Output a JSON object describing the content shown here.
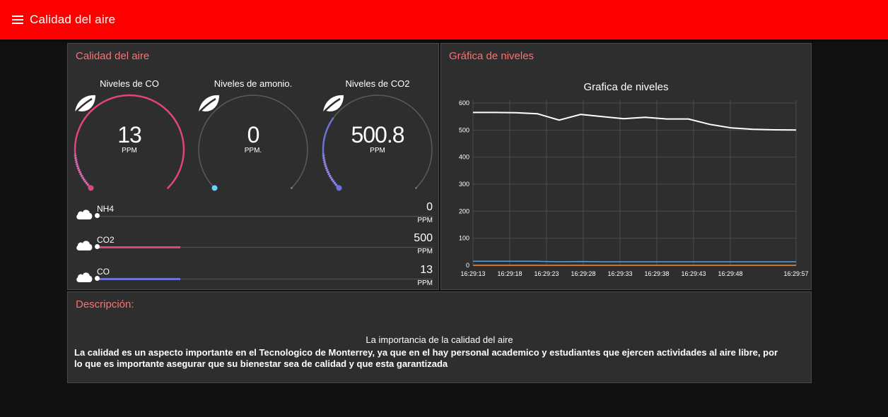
{
  "app": {
    "title": "Calidad del aire"
  },
  "panels": {
    "air": {
      "title": "Calidad del aire"
    },
    "chart": {
      "title": "Gráfica de niveles"
    },
    "description": {
      "title": "Descripción:"
    }
  },
  "gauges": [
    {
      "label": "Niveles de CO",
      "value": "13",
      "unit": "PPM",
      "fraction": 1.0,
      "color": "#e0467c"
    },
    {
      "label": "Niveles de amonio.",
      "value": "0",
      "unit": "PPM.",
      "fraction": 0.0,
      "color": "#3cb371"
    },
    {
      "label": "Niveles de CO2",
      "value": "500.8",
      "unit": "PPM",
      "fraction": 0.3,
      "color": "#6b74d6"
    }
  ],
  "levels": [
    {
      "name": "NH4",
      "value": "0",
      "unit": "PPM",
      "fraction": 0.0,
      "color": "#ffffff"
    },
    {
      "name": "CO2",
      "value": "500",
      "unit": "PPM",
      "fraction": 0.25,
      "color": "#e0467c"
    },
    {
      "name": "CO",
      "value": "13",
      "unit": "PPM",
      "fraction": 0.25,
      "color": "#6b74d6"
    }
  ],
  "chart_data": {
    "type": "line",
    "title": "Grafica de niveles",
    "xlabel": "",
    "ylabel": "",
    "ylim": [
      0,
      600
    ],
    "yticks": [
      "0",
      "100",
      "200",
      "300",
      "400",
      "500",
      "600"
    ],
    "xticks": [
      "16:29:13",
      "16:29:18",
      "16:29:23",
      "16:29:28",
      "16:29:33",
      "16:29:38",
      "16:29:43",
      "16:29:48",
      "16:29:57"
    ],
    "grid": true,
    "series": [
      {
        "color": "#ffffff",
        "values": [
          565,
          565,
          564,
          560,
          537,
          558,
          550,
          542,
          547,
          541,
          541,
          521,
          508,
          503,
          501,
          500
        ]
      },
      {
        "color": "#5aa0d8",
        "values": [
          15,
          15,
          15,
          15,
          13,
          14,
          13,
          13,
          13,
          13,
          13,
          13,
          13,
          13,
          13,
          13
        ]
      },
      {
        "color": "#ff8c2e",
        "values": [
          0,
          0,
          0,
          0,
          0,
          0,
          0,
          0,
          0,
          0,
          0,
          0,
          0,
          0,
          0,
          0
        ]
      }
    ]
  },
  "description": {
    "subtitle": "La importancia de la calidad del aire",
    "body": "La calidad es un aspecto importante en el Tecnologico de Monterrey, ya que en el hay personal academico y estudiantes que ejercen actividades al aire libre, por lo que es importante asegurar que su bienestar sea de calidad y que esta garantizada"
  }
}
